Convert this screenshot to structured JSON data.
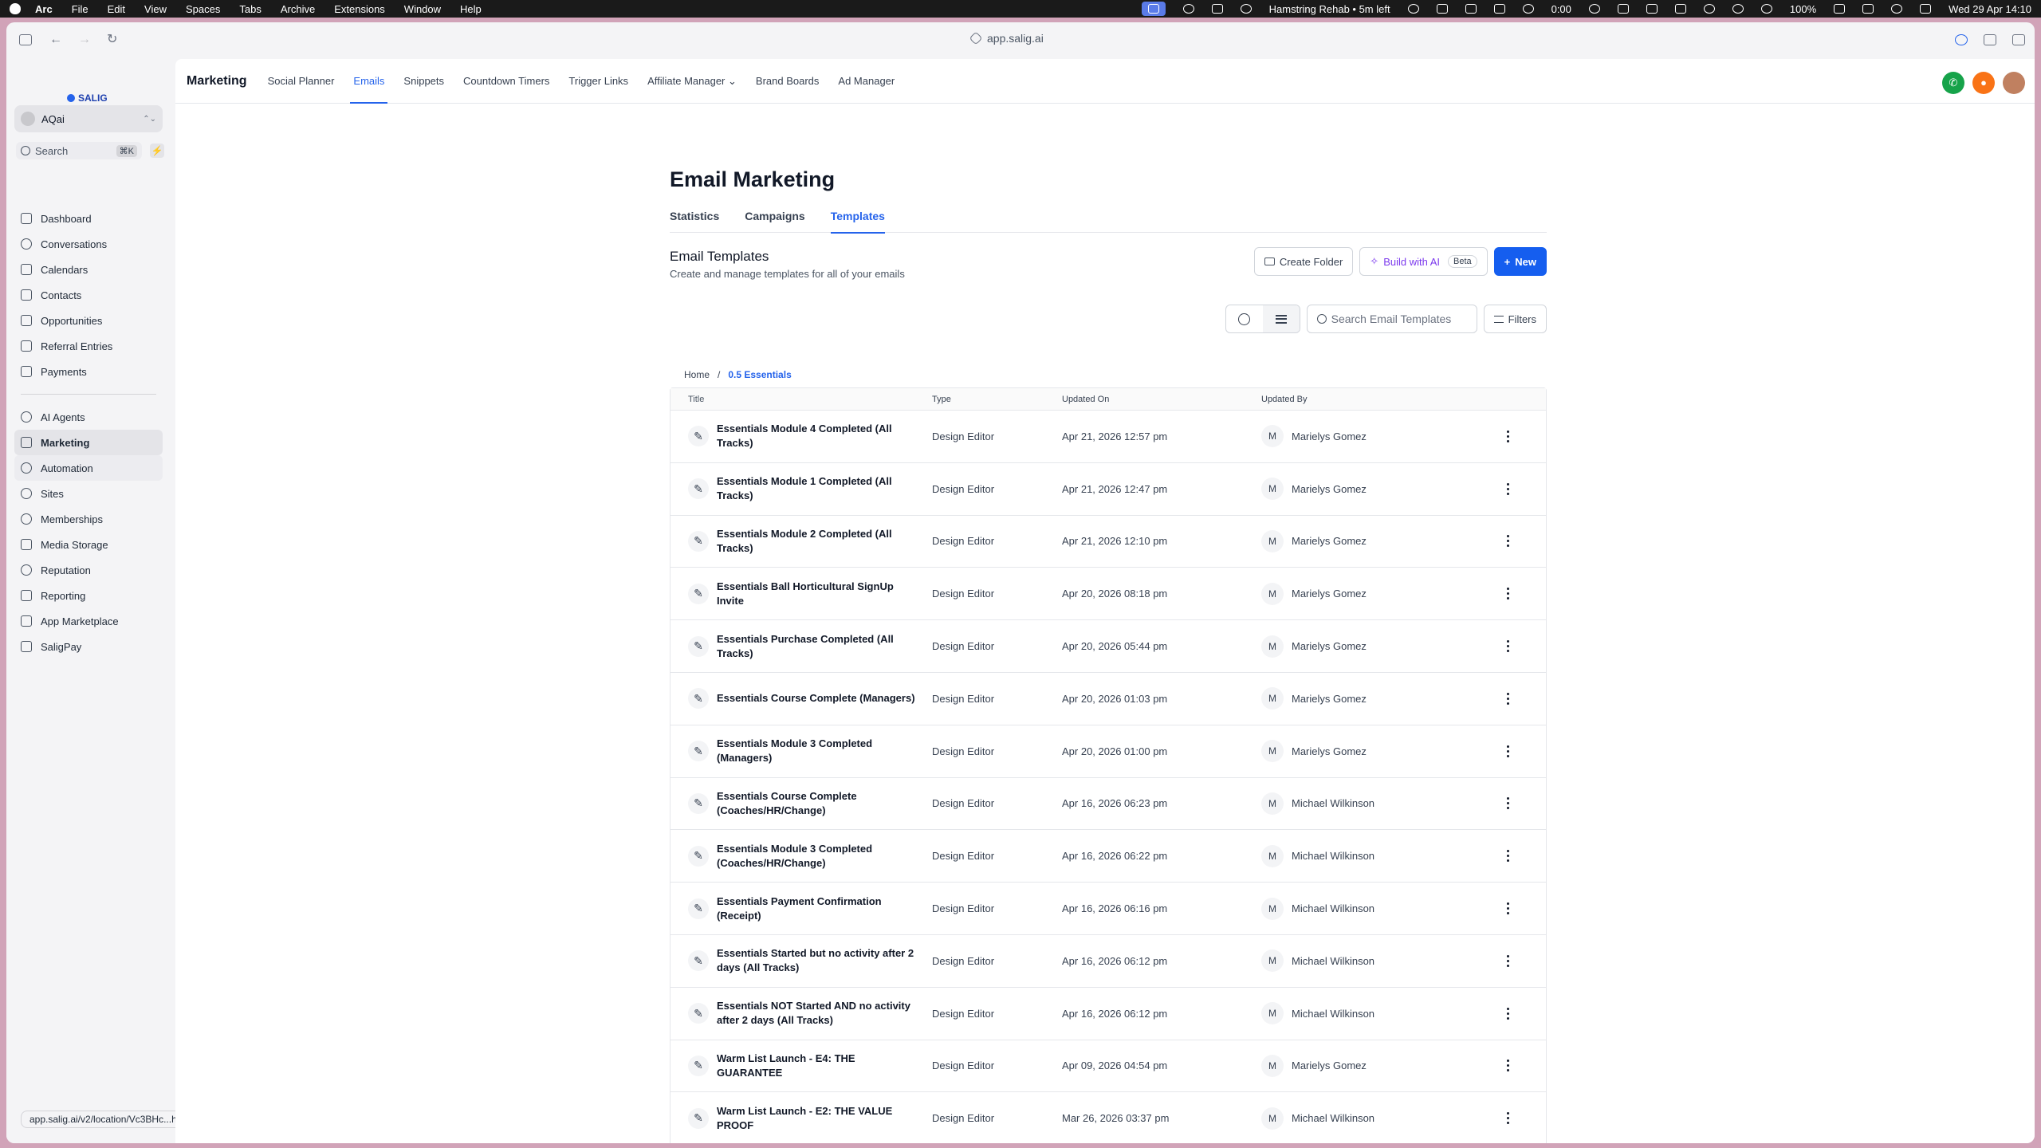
{
  "menubar": {
    "items": [
      "Arc",
      "File",
      "Edit",
      "View",
      "Spaces",
      "Tabs",
      "Archive",
      "Extensions",
      "Window",
      "Help"
    ],
    "reminder": "Hamstring Rehab • 5m left",
    "timer": "0:00",
    "battery": "100%",
    "clock": "Wed 29 Apr  14:10"
  },
  "browser": {
    "url": "app.salig.ai"
  },
  "sidebar": {
    "logo": "SALIG",
    "account": "AQai",
    "search_label": "Search",
    "search_shortcut": "⌘K",
    "group1": [
      {
        "label": "Dashboard",
        "icon": "dashboard-icon"
      },
      {
        "label": "Conversations",
        "icon": "chat-icon"
      },
      {
        "label": "Calendars",
        "icon": "calendar-icon"
      },
      {
        "label": "Contacts",
        "icon": "contacts-icon"
      },
      {
        "label": "Opportunities",
        "icon": "opportunities-icon"
      },
      {
        "label": "Referral Entries",
        "icon": "referral-icon"
      },
      {
        "label": "Payments",
        "icon": "payments-icon"
      }
    ],
    "group2": [
      {
        "label": "AI Agents",
        "icon": "sparkle-icon"
      },
      {
        "label": "Marketing",
        "icon": "send-icon"
      },
      {
        "label": "Automation",
        "icon": "automation-icon"
      },
      {
        "label": "Sites",
        "icon": "globe-icon"
      },
      {
        "label": "Memberships",
        "icon": "badge-icon"
      },
      {
        "label": "Media Storage",
        "icon": "image-icon"
      },
      {
        "label": "Reputation",
        "icon": "star-icon"
      },
      {
        "label": "Reporting",
        "icon": "chart-icon"
      },
      {
        "label": "App Marketplace",
        "icon": "grid-icon"
      },
      {
        "label": "SaligPay",
        "icon": "pay-icon"
      }
    ],
    "status_url": "app.salig.ai/v2/location/Vc3BHc...hew4w2HI/automation/workflows"
  },
  "topnav": {
    "section": "Marketing",
    "tabs": [
      "Social Planner",
      "Emails",
      "Snippets",
      "Countdown Timers",
      "Trigger Links",
      "Affiliate Manager",
      "Brand Boards",
      "Ad Manager"
    ]
  },
  "page": {
    "title": "Email Marketing",
    "subtabs": [
      "Statistics",
      "Campaigns",
      "Templates"
    ],
    "section_title": "Email Templates",
    "section_sub": "Create and manage templates for all of your emails",
    "create_folder": "Create Folder",
    "build_ai": "Build with AI",
    "beta": "Beta",
    "new": "New",
    "search_placeholder": "Search Email Templates",
    "filters": "Filters",
    "breadcrumb": [
      "Home",
      "0.5 Essentials"
    ]
  },
  "table": {
    "headers": [
      "Title",
      "Type",
      "Updated On",
      "Updated By"
    ],
    "rows": [
      {
        "title": "Essentials Module 4 Completed (All Tracks)",
        "type": "Design Editor",
        "updated": "Apr 21, 2026 12:57 pm",
        "by": "Marielys Gomez",
        "initial": "M"
      },
      {
        "title": "Essentials Module 1 Completed (All Tracks)",
        "type": "Design Editor",
        "updated": "Apr 21, 2026 12:47 pm",
        "by": "Marielys Gomez",
        "initial": "M"
      },
      {
        "title": "Essentials Module 2 Completed (All Tracks)",
        "type": "Design Editor",
        "updated": "Apr 21, 2026 12:10 pm",
        "by": "Marielys Gomez",
        "initial": "M"
      },
      {
        "title": "Essentials Ball Horticultural SignUp Invite",
        "type": "Design Editor",
        "updated": "Apr 20, 2026 08:18 pm",
        "by": "Marielys Gomez",
        "initial": "M"
      },
      {
        "title": "Essentials Purchase Completed (All Tracks)",
        "type": "Design Editor",
        "updated": "Apr 20, 2026 05:44 pm",
        "by": "Marielys Gomez",
        "initial": "M"
      },
      {
        "title": "Essentials Course Complete (Managers)",
        "type": "Design Editor",
        "updated": "Apr 20, 2026 01:03 pm",
        "by": "Marielys Gomez",
        "initial": "M"
      },
      {
        "title": "Essentials Module 3 Completed (Managers)",
        "type": "Design Editor",
        "updated": "Apr 20, 2026 01:00 pm",
        "by": "Marielys Gomez",
        "initial": "M"
      },
      {
        "title": "Essentials Course Complete (Coaches/HR/Change)",
        "type": "Design Editor",
        "updated": "Apr 16, 2026 06:23 pm",
        "by": "Michael Wilkinson",
        "initial": "M"
      },
      {
        "title": "Essentials Module 3 Completed (Coaches/HR/Change)",
        "type": "Design Editor",
        "updated": "Apr 16, 2026 06:22 pm",
        "by": "Michael Wilkinson",
        "initial": "M"
      },
      {
        "title": "Essentials Payment Confirmation (Receipt)",
        "type": "Design Editor",
        "updated": "Apr 16, 2026 06:16 pm",
        "by": "Michael Wilkinson",
        "initial": "M"
      },
      {
        "title": "Essentials Started but no activity after 2 days (All Tracks)",
        "type": "Design Editor",
        "updated": "Apr 16, 2026 06:12 pm",
        "by": "Michael Wilkinson",
        "initial": "M"
      },
      {
        "title": "Essentials NOT Started AND no activity after 2 days (All Tracks)",
        "type": "Design Editor",
        "updated": "Apr 16, 2026 06:12 pm",
        "by": "Michael Wilkinson",
        "initial": "M"
      },
      {
        "title": "Warm List Launch - E4: THE GUARANTEE",
        "type": "Design Editor",
        "updated": "Apr 09, 2026 04:54 pm",
        "by": "Marielys Gomez",
        "initial": "M"
      },
      {
        "title": "Warm List Launch - E2: THE VALUE PROOF",
        "type": "Design Editor",
        "updated": "Mar 26, 2026 03:37 pm",
        "by": "Michael Wilkinson",
        "initial": "M"
      }
    ]
  },
  "colors": {
    "accent": "#155eef",
    "link": "#2563eb",
    "frame": "#d1a3b8"
  }
}
